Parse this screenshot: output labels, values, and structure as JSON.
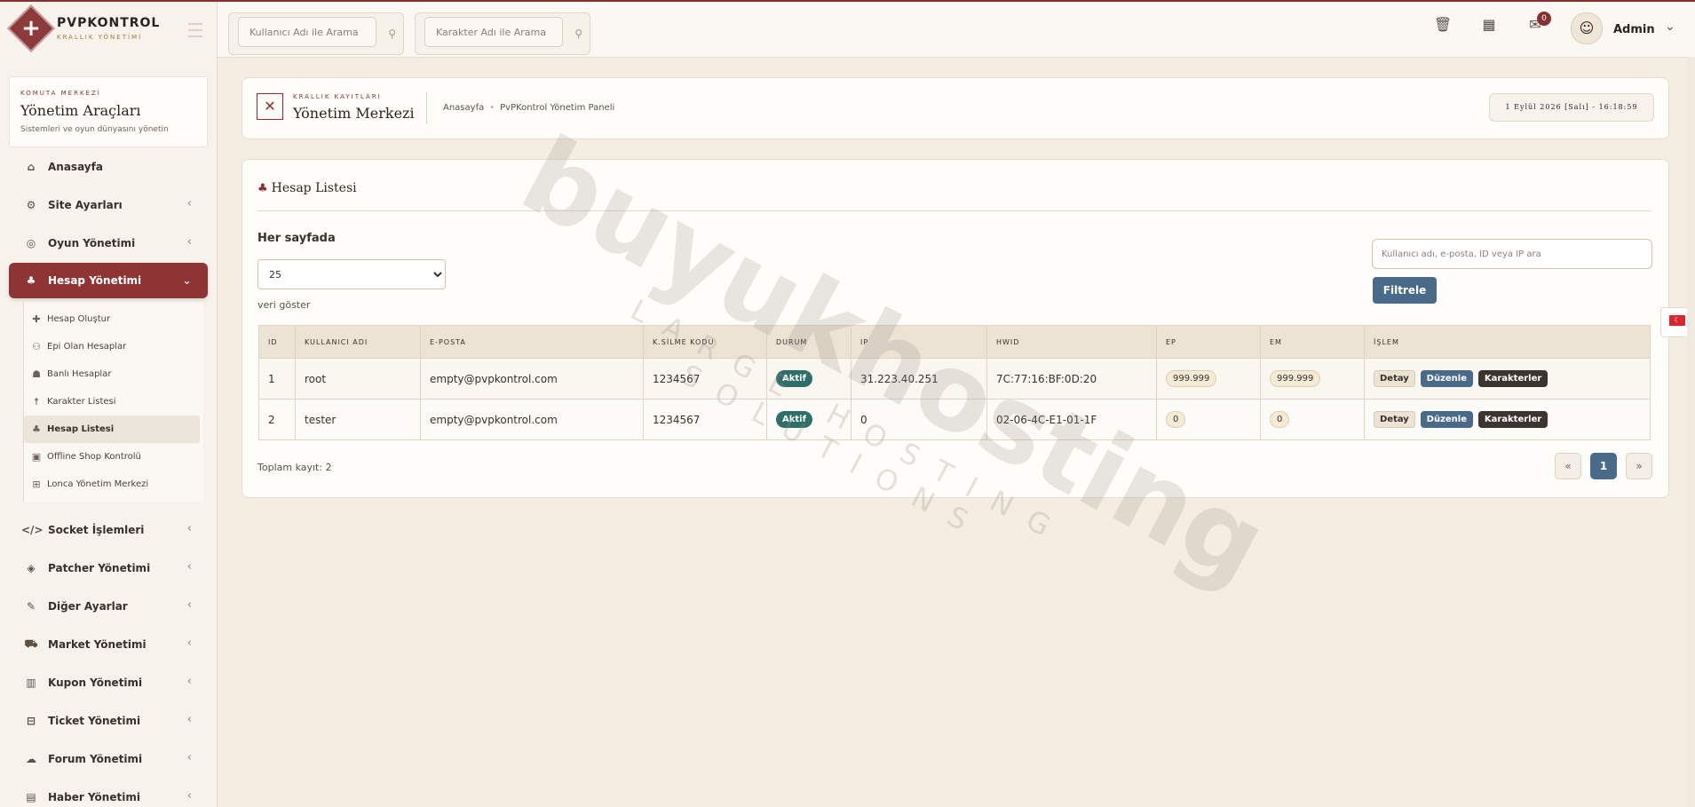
{
  "brand": {
    "name": "PVPKONTROL",
    "subtitle": "KRALLIK YÖNETİMİ"
  },
  "sidebar": {
    "kicker": "KOMUTA MERKEZİ",
    "title": "Yönetim Araçları",
    "subtitle": "Sistemleri ve oyun dünyasını yönetin",
    "items": [
      {
        "label": "Anasayfa",
        "icon": "home-icon"
      },
      {
        "label": "Site Ayarları",
        "icon": "gear-icon"
      },
      {
        "label": "Oyun Yönetimi",
        "icon": "gamepad-icon"
      },
      {
        "label": "Hesap Yönetimi",
        "icon": "users-icon"
      },
      {
        "label": "Socket İşlemleri",
        "icon": "code-icon"
      },
      {
        "label": "Patcher Yönetimi",
        "icon": "box-icon"
      },
      {
        "label": "Diğer Ayarlar",
        "icon": "wrench-icon"
      },
      {
        "label": "Market Yönetimi",
        "icon": "cart-icon"
      },
      {
        "label": "Kupon Yönetimi",
        "icon": "barcode-icon"
      },
      {
        "label": "Ticket Yönetimi",
        "icon": "ticket-icon"
      },
      {
        "label": "Forum Yönetimi",
        "icon": "comments-icon"
      },
      {
        "label": "Haber Yönetimi",
        "icon": "newspaper-icon"
      }
    ],
    "submenu": [
      {
        "label": "Hesap Oluştur",
        "icon": "plus-icon"
      },
      {
        "label": "Epi Olan Hesaplar",
        "icon": "users-gear-icon"
      },
      {
        "label": "Banlı Hesaplar",
        "icon": "user-lock-icon"
      },
      {
        "label": "Karakter Listesi",
        "icon": "person-icon"
      },
      {
        "label": "Hesap Listesi",
        "icon": "users-icon"
      },
      {
        "label": "Offline Shop Kontrolü",
        "icon": "shop-icon"
      },
      {
        "label": "Lonca Yönetim Merkezi",
        "icon": "sitemap-icon"
      }
    ]
  },
  "topbar": {
    "search_user_placeholder": "Kullanıcı Adı ile Arama",
    "search_char_placeholder": "Karakter Adı ile Arama",
    "notification_count": "0",
    "user_name": "Admin"
  },
  "header": {
    "kicker": "KRALLIK KAYITLARI",
    "title": "Yönetim Merkezi",
    "breadcrumb_home": "Anasayfa",
    "breadcrumb_current": "PvPKontrol Yönetim Paneli",
    "datetime": "1 Eylül 2026 [Salı] - 16:18:59"
  },
  "main": {
    "title": "Hesap Listesi",
    "perpage_label": "Her sayfada",
    "perpage_value": "25",
    "perpage_after": "veri göster",
    "filter_placeholder": "Kullanıcı adı, e-posta, ID veya IP ara",
    "filter_button": "Filtrele",
    "columns": [
      "ID",
      "KULLANICI ADI",
      "E-POSTA",
      "K.SİLME KODU",
      "DURUM",
      "IP",
      "HWID",
      "EP",
      "EM",
      "İŞLEM"
    ],
    "rows": [
      {
        "id": "1",
        "username": "root",
        "email": "empty@pvpkontrol.com",
        "delete_code": "1234567",
        "status": "Aktif",
        "ip": "31.223.40.251",
        "hwid": "7C:77:16:BF:0D:20",
        "ep": "999.999",
        "em": "999.999"
      },
      {
        "id": "2",
        "username": "tester",
        "email": "empty@pvpkontrol.com",
        "delete_code": "1234567",
        "status": "Aktif",
        "ip": "0",
        "hwid": "02-06-4C-E1-01-1F",
        "ep": "0",
        "em": "0"
      }
    ],
    "actions": {
      "detail": "Detay",
      "edit": "Düzenle",
      "characters": "Karakterler"
    },
    "total": "Toplam kayıt: 2",
    "pagination": {
      "prev": "«",
      "current": "1",
      "next": "»"
    }
  },
  "watermark": {
    "main": "buyukhosting",
    "sub": "LARGE HOSTING SOLUTIONS"
  },
  "colors": {
    "accent": "#8f3434",
    "blue": "#4a6a8a",
    "teal": "#2f6f6a"
  }
}
